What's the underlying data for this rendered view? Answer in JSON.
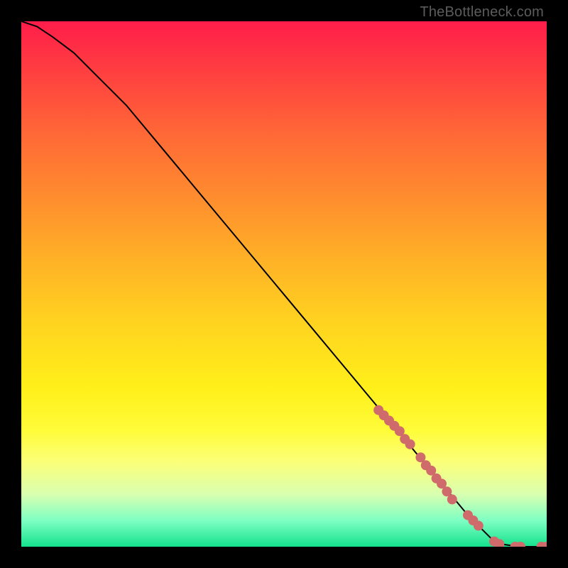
{
  "watermark": "TheBottleneck.com",
  "chart_data": {
    "type": "line",
    "title": "",
    "xlabel": "",
    "ylabel": "",
    "xlim": [
      0,
      100
    ],
    "ylim": [
      0,
      100
    ],
    "x": [
      0,
      3,
      6,
      10,
      15,
      20,
      25,
      30,
      35,
      40,
      45,
      50,
      55,
      60,
      65,
      70,
      75,
      80,
      85,
      88,
      90,
      92,
      94,
      96,
      98,
      100
    ],
    "values": [
      100,
      99,
      97,
      94,
      89,
      84,
      78,
      72,
      66,
      60,
      54,
      48,
      42,
      36,
      30,
      24,
      18,
      12,
      6,
      3,
      1,
      0.4,
      0.1,
      0,
      0,
      0
    ],
    "markers": {
      "color": "#cf6b6b",
      "radius_px": 7,
      "points_xy": [
        [
          68,
          26
        ],
        [
          69,
          25
        ],
        [
          70,
          24
        ],
        [
          71,
          23
        ],
        [
          72,
          22
        ],
        [
          73,
          20.5
        ],
        [
          74,
          19.5
        ],
        [
          76,
          17
        ],
        [
          77,
          15.5
        ],
        [
          78,
          14.5
        ],
        [
          79,
          13
        ],
        [
          80,
          12
        ],
        [
          81,
          10.5
        ],
        [
          82,
          9
        ],
        [
          85,
          6
        ],
        [
          86,
          5
        ],
        [
          87,
          4
        ],
        [
          90,
          1
        ],
        [
          91,
          0.5
        ],
        [
          94,
          0
        ],
        [
          95,
          0
        ],
        [
          99,
          0
        ],
        [
          100,
          0
        ]
      ]
    }
  }
}
